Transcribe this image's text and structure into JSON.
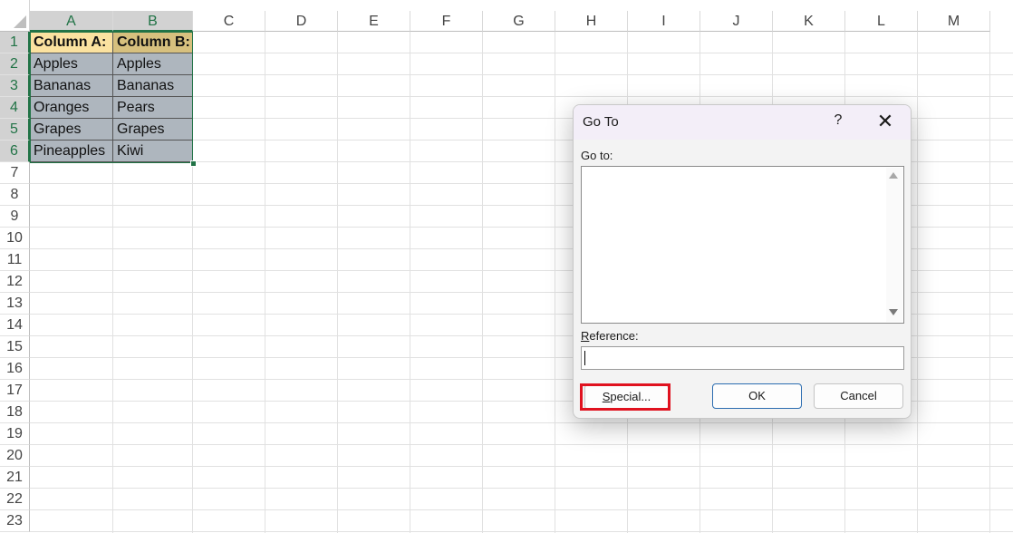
{
  "sheet": {
    "columns": [
      "A",
      "B",
      "C",
      "D",
      "E",
      "F",
      "G",
      "H",
      "I",
      "J",
      "K",
      "L",
      "M"
    ],
    "rows": [
      "1",
      "2",
      "3",
      "4",
      "5",
      "6",
      "7",
      "8",
      "9",
      "10",
      "11",
      "12",
      "13",
      "14",
      "15",
      "16",
      "17",
      "18",
      "19",
      "20",
      "21",
      "22",
      "23"
    ],
    "headers": {
      "a": "Column A:",
      "b": "Column B:"
    },
    "data": [
      {
        "a": "Apples",
        "b": "Apples"
      },
      {
        "a": "Bananas",
        "b": "Bananas"
      },
      {
        "a": "Oranges",
        "b": "Pears"
      },
      {
        "a": "Grapes",
        "b": "Grapes"
      },
      {
        "a": "Pineapples",
        "b": "Kiwi"
      }
    ]
  },
  "dialog": {
    "title": "Go To",
    "help_glyph": "?",
    "close_glyph": "✕",
    "goto_label": "Go to:",
    "reference_label_underlined": "R",
    "reference_label_rest": "eference:",
    "reference_value": "",
    "special_label_underlined": "S",
    "special_label_rest": "pecial...",
    "ok_label": "OK",
    "cancel_label": "Cancel"
  },
  "colors": {
    "selection": "#217346",
    "highlight": "#e0121f",
    "header_fill_a": "#fbe2a0",
    "header_fill_b": "#d7c07e",
    "data_fill": "#aeb6be"
  }
}
